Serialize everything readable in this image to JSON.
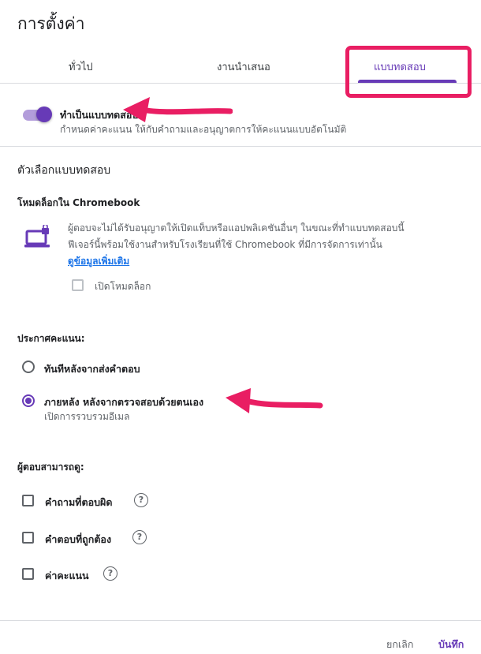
{
  "dialog": {
    "title": "การตั้งค่า"
  },
  "tabs": [
    {
      "label": "ทั่วไป",
      "active": false
    },
    {
      "label": "งานนำเสนอ",
      "active": false
    },
    {
      "label": "แบบทดสอบ",
      "active": true
    }
  ],
  "quiz_toggle": {
    "label": "ทำเป็นแบบทดสอบ",
    "description": "กำหนดค่าคะแนน ให้กับคำถามและอนุญาตการให้คะแนนแบบอัตโนมัติ",
    "on": true
  },
  "quiz_options": {
    "heading": "ตัวเลือกแบบทดสอบ",
    "lock_mode": {
      "heading": "โหมดล็อกใน Chromebook",
      "description_line1": "ผู้ตอบจะไม่ได้รับอนุญาตให้เปิดแท็บหรือแอปพลิเคชันอื่นๆ ในขณะที่ทำแบบทดสอบนี้",
      "description_line2": "ฟีเจอร์นี้พร้อมใช้งานสำหรับโรงเรียนที่ใช้ Chromebook ที่มีการจัดการเท่านั้น",
      "learn_more": "ดูข้อมูลเพิ่มเติม",
      "checkbox_label": "เปิดโหมดล็อก"
    }
  },
  "release_grade": {
    "heading": "ประกาศคะแนน:",
    "options": [
      {
        "label": "ทันทีหลังจากส่งคำตอบ",
        "selected": false
      },
      {
        "label": "ภายหลัง หลังจากตรวจสอบด้วยตนเอง",
        "sub": "เปิดการรวบรวมอีเมล",
        "selected": true
      }
    ]
  },
  "respondent_can_see": {
    "heading": "ผู้ตอบสามารถดู:",
    "options": [
      {
        "label": "คำถามที่ตอบผิด",
        "checked": false
      },
      {
        "label": "คำตอบที่ถูกต้อง",
        "checked": false
      },
      {
        "label": "ค่าคะแนน",
        "checked": false
      }
    ]
  },
  "footer": {
    "cancel": "ยกเลิก",
    "save": "บันทึก"
  },
  "colors": {
    "accent": "#673ab7",
    "annotation": "#e91e63",
    "link": "#1a73e8"
  },
  "icons": {
    "help": "?",
    "laptop": "laptop-lock-icon"
  }
}
